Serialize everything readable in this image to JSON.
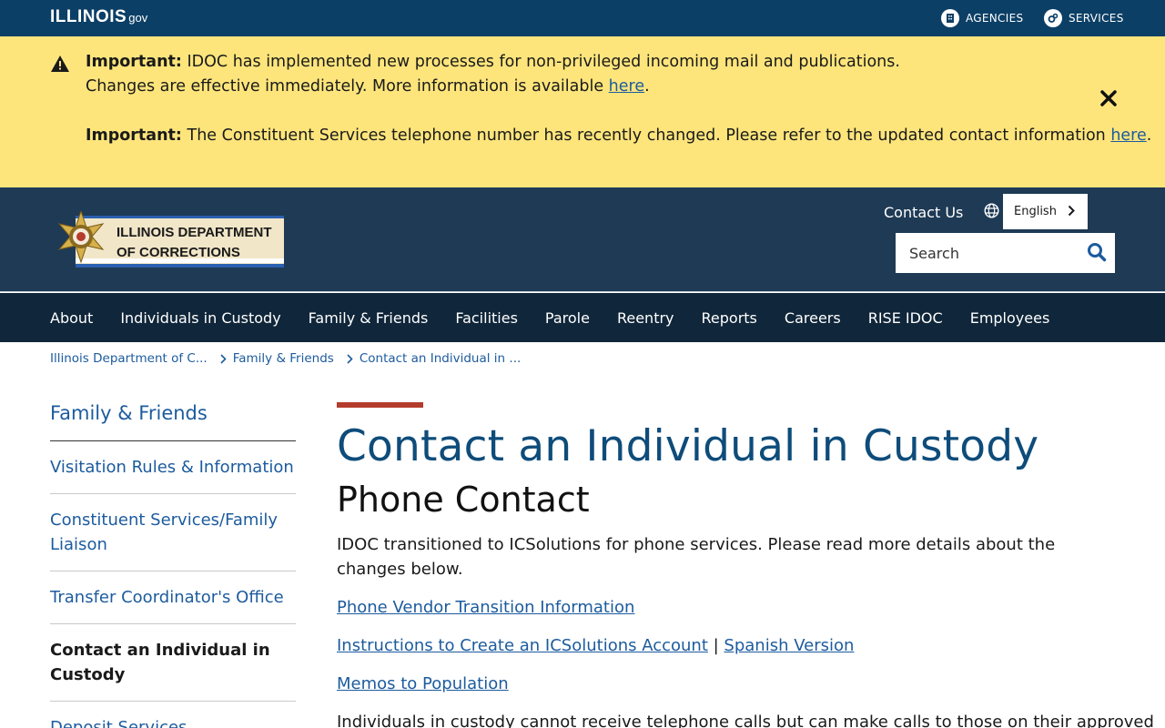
{
  "gov_bar": {
    "logo_main": "ILLINOIS",
    "logo_suffix": "gov",
    "agencies": "AGENCIES",
    "services": "SERVICES"
  },
  "alert": {
    "line1_bold": "Important:",
    "line1_text": " IDOC has implemented new processes for non-privileged incoming mail and publications.",
    "line2_text": "Changes are effective immediately. More information is available ",
    "line2_link": "here",
    "line2_end": ".",
    "line3_bold": "Important:",
    "line3_text": " The Constituent Services telephone number has recently changed. Please refer to the updated contact information ",
    "line3_link": "here",
    "line3_end": "."
  },
  "header": {
    "logo_line1": "ILLINOIS DEPARTMENT",
    "logo_line2": "OF CORRECTIONS",
    "contact_us": "Contact Us",
    "language": "English",
    "search_placeholder": "Search"
  },
  "nav": {
    "items": [
      "About",
      "Individuals in Custody",
      "Family & Friends",
      "Facilities",
      "Parole",
      "Reentry",
      "Reports",
      "Careers",
      "RISE IDOC",
      "Employees"
    ]
  },
  "breadcrumb": {
    "items": [
      "Illinois Department of C...",
      "Family & Friends",
      "Contact an Individual in ..."
    ]
  },
  "sidebar": {
    "title": "Family & Friends",
    "items": [
      "Visitation Rules & Information",
      "Constituent Services/Family Liaison",
      "Transfer Coordinator's Office",
      "Contact an Individual in Custody",
      "Deposit Services"
    ]
  },
  "content": {
    "title": "Contact an Individual in Custody",
    "subtitle": "Phone Contact",
    "intro": "IDOC transitioned to ICSolutions for phone services. Please read more details about the changes below.",
    "link1": "Phone Vendor Transition Information",
    "link2": "Instructions to Create an ICSolutions Account",
    "link2_sep": " | ",
    "link3": "Spanish Version",
    "link4": "Memos to Population",
    "tail": "Individuals in custody cannot receive telephone calls but can make calls to those on their approved"
  },
  "colors": {
    "gov_bar": "#0c3f66",
    "alert_bg": "#fde57c",
    "header_bg": "#1e3a55",
    "nav_bg": "#10263a",
    "link": "#1c5b9e",
    "heading": "#0e4c7a",
    "accent_red": "#b43c2c"
  }
}
